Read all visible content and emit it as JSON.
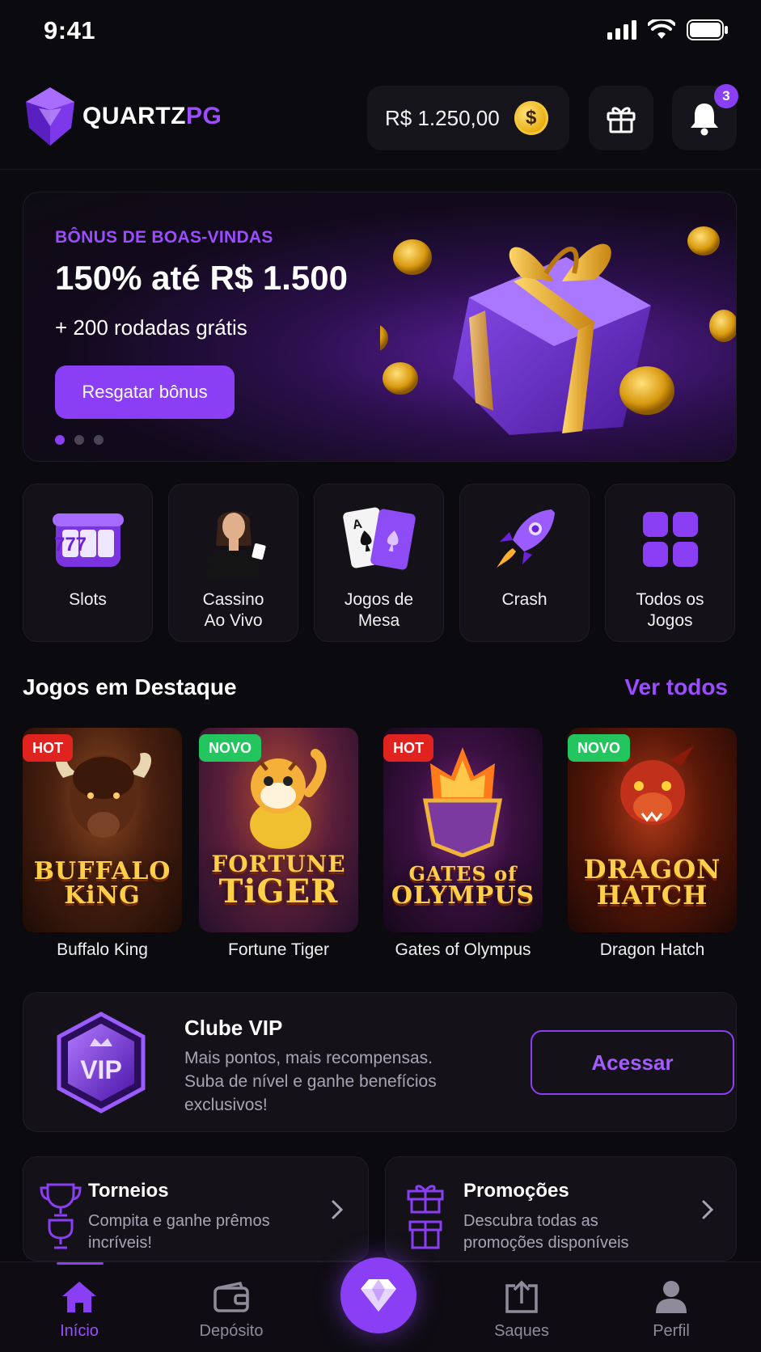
{
  "status_bar": {
    "time": "9:41"
  },
  "header": {
    "logo_text_1": "QUARTZ",
    "logo_text_2": "PG",
    "balance": "R$ 1.250,00",
    "coin_symbol": "$",
    "notification_count": "3"
  },
  "banner": {
    "kicker": "BÔNUS DE BOAS-VINDAS",
    "headline": "150% até R$ 1.500",
    "subline": "+ 200 rodadas grátis",
    "cta_label": "Resgatar bônus",
    "slides_total": 3,
    "slide_active": 1
  },
  "categories": [
    {
      "label": "Slots",
      "icon": "slot-machine-icon",
      "reels": "777"
    },
    {
      "label": "Cassino\nAo Vivo",
      "icon": "live-dealer-icon"
    },
    {
      "label": "Jogos de\nMesa",
      "icon": "playing-cards-icon",
      "card_rank": "A"
    },
    {
      "label": "Crash",
      "icon": "rocket-icon"
    },
    {
      "label": "Todos os\nJogos",
      "icon": "grid-icon"
    }
  ],
  "featured": {
    "title": "Jogos em Destaque",
    "see_all": "Ver todos",
    "games": [
      {
        "name": "Buffalo King",
        "tag": "HOT",
        "art_line_1": "BUFFALO",
        "art_line_2": "KiNG"
      },
      {
        "name": "Fortune Tiger",
        "tag": "NOVO",
        "art_line_1": "FORTUNE",
        "art_line_2": "TiGER"
      },
      {
        "name": "Gates of Olympus",
        "tag": "HOT",
        "art_line_1": "GATES of",
        "art_line_2": "OLYMPUS"
      },
      {
        "name": "Dragon Hatch",
        "tag": "NOVO",
        "art_line_1": "DRAGON",
        "art_line_2": "HATCH"
      }
    ]
  },
  "vip": {
    "badge_text": "VIP",
    "title": "Clube VIP",
    "description": "Mais pontos, mais recompensas. Suba de nível e ganhe benefícios exclusivos!",
    "button": "Acessar"
  },
  "promo_cards": [
    {
      "title": "Torneios",
      "description": "Compita e ganhe prêmos incríveis!",
      "icon": "trophy-icon"
    },
    {
      "title": "Promoções",
      "description": "Descubra todas as promoções disponíveis",
      "icon": "gift-icon"
    }
  ],
  "bottom_nav": {
    "items": [
      {
        "label": "Início",
        "icon": "home-icon",
        "active": true
      },
      {
        "label": "Depósito",
        "icon": "wallet-icon"
      },
      {
        "label": "Saques",
        "icon": "upload-icon"
      },
      {
        "label": "Perfil",
        "icon": "user-icon"
      }
    ]
  },
  "colors": {
    "accent": "#8a3ff5",
    "background": "#0b0a0e",
    "card": "#141218",
    "hot": "#e0231e",
    "novo": "#22c55e",
    "gold": "#e6a90a"
  }
}
